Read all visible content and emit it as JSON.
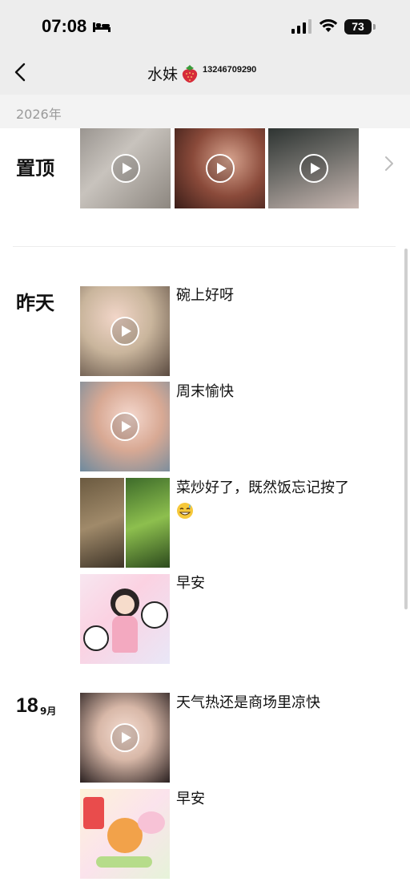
{
  "status": {
    "time": "07:08",
    "battery": "73"
  },
  "nav": {
    "title": "水妹",
    "phone": "13246709290"
  },
  "year_header": "2026年",
  "sections": {
    "pinned": {
      "label": "置顶"
    },
    "yesterday": {
      "label": "昨天",
      "posts": [
        {
          "caption": "碗上好呀",
          "type": "video"
        },
        {
          "caption": "周末愉快",
          "type": "video"
        },
        {
          "caption": "菜炒好了，既然饭忘记按了",
          "type": "photos",
          "emoji": "grin-sweat-emoji"
        },
        {
          "caption": "早安",
          "type": "photo"
        }
      ]
    },
    "sep18": {
      "day": "18",
      "month": "9月",
      "posts": [
        {
          "caption": "天气热还是商场里凉快",
          "type": "video"
        },
        {
          "caption": "早安",
          "type": "photo"
        }
      ]
    }
  },
  "colors": {
    "header_bg": "#ededed",
    "year_bar_bg": "#f3f3f3",
    "year_text": "#9a9a9a"
  }
}
